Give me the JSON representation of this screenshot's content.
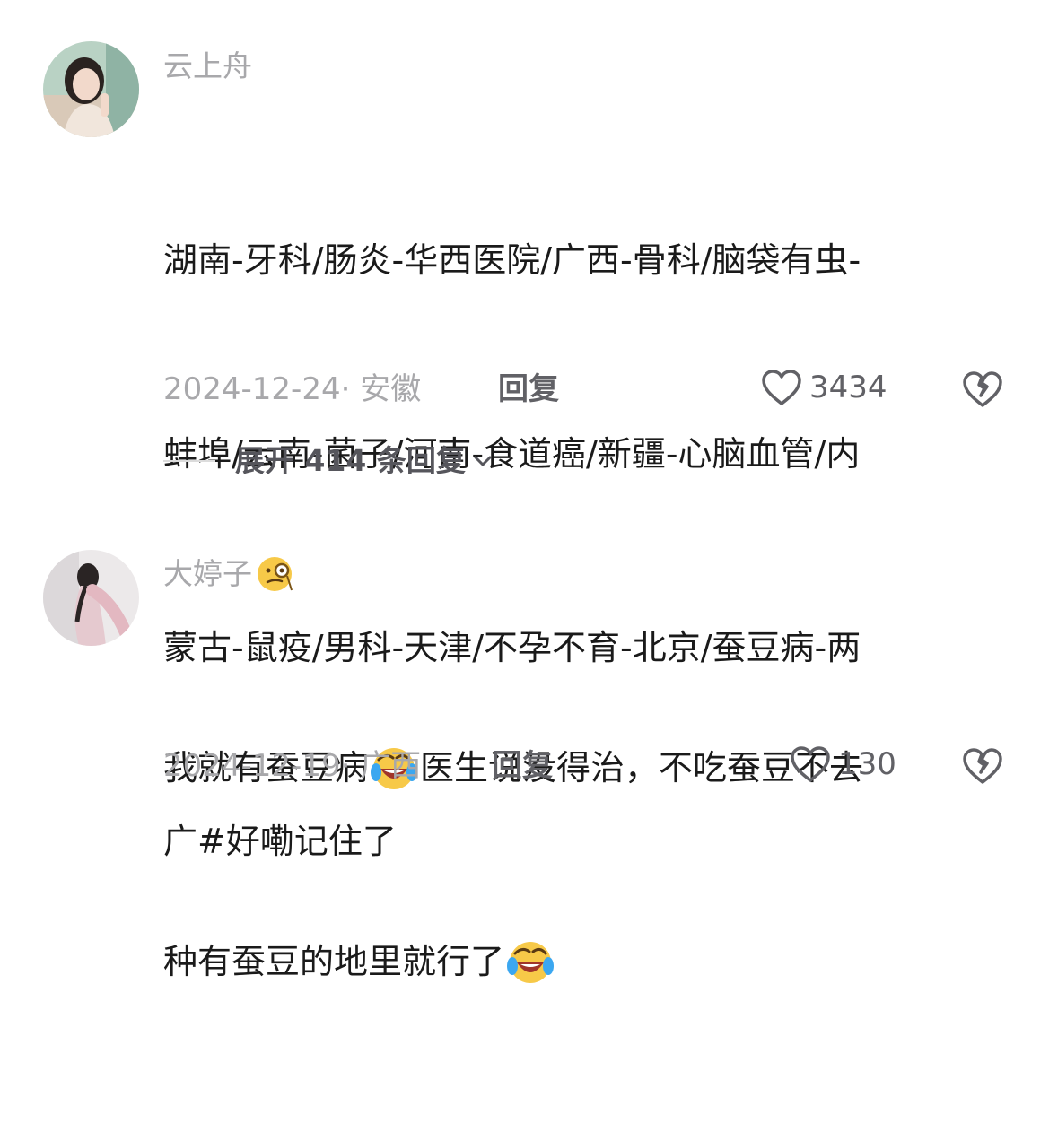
{
  "comments": [
    {
      "author": "云上舟",
      "author_emoji": "",
      "lines": [
        "湖南-牙科/肠炎-华西医院/广西-骨科/脑袋有虫-",
        "蚌埠/云南-菌子/河南-食道癌/新疆-心脑血管/内",
        "蒙古-鼠疫/男科-天津/不孕不育-北京/蚕豆病-两",
        "广#好嘞记住了"
      ],
      "date_location": "2024-12-24· 安徽",
      "reply_label": "回复",
      "likes": "3434",
      "expand_label": "展开 414 条回复",
      "avatar_icon": "avatar-woman-photo"
    },
    {
      "author": "大婷子",
      "author_emoji": "monocle-face-emoji",
      "lines_parts": [
        [
          "我就有蚕豆病",
          "crying-laugh-emoji",
          "医生说没得治，不吃蚕豆不去"
        ],
        [
          "种有蚕豆的地里就行了",
          "crying-laugh-emoji",
          ""
        ]
      ],
      "date_location": "2024-12-19· 广西",
      "reply_label": "回复",
      "likes": "130",
      "avatar_icon": "avatar-woman-photo"
    }
  ],
  "colors": {
    "text": "#1a1a1a",
    "muted": "#a8a8ab",
    "action": "#616166"
  }
}
